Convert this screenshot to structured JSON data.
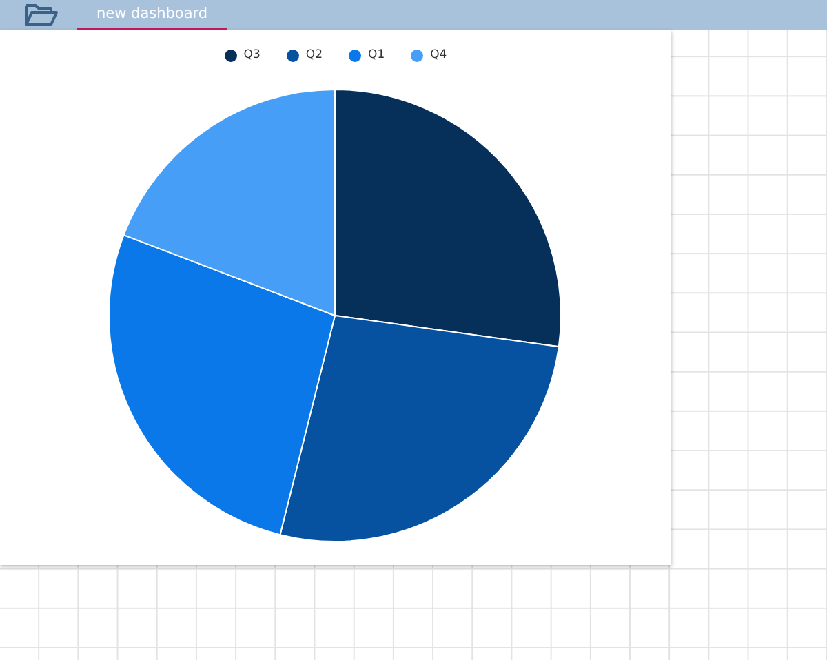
{
  "tabs": [
    {
      "label": "new dashboard",
      "selected": true
    }
  ],
  "legend": [
    {
      "label": "Q3",
      "color": "#062f5a"
    },
    {
      "label": "Q2",
      "color": "#0652a0"
    },
    {
      "label": "Q1",
      "color": "#0a78e8"
    },
    {
      "label": "Q4",
      "color": "#469ef6"
    }
  ]
}
